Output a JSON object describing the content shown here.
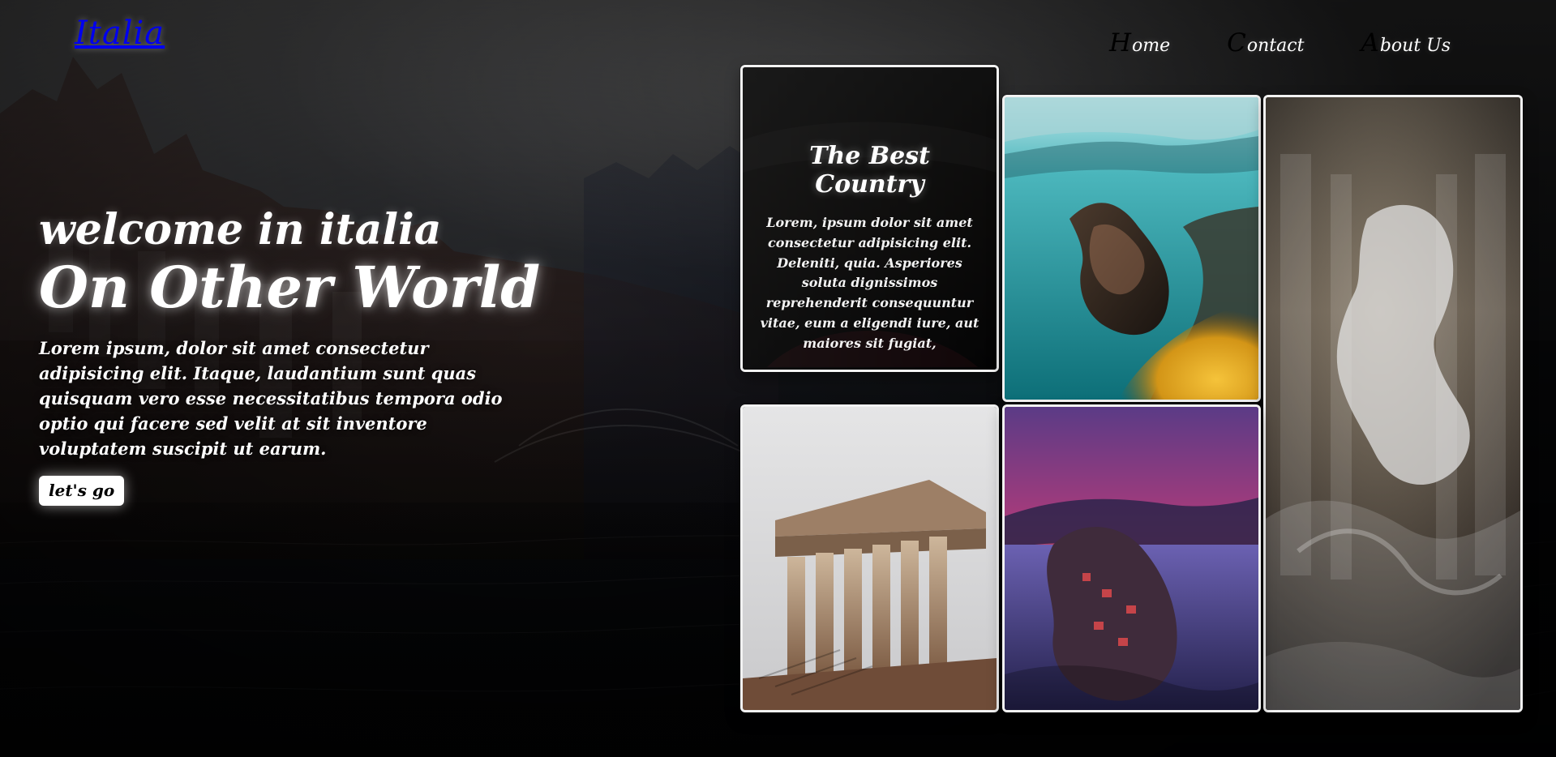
{
  "brand": {
    "logo_text": "Italia"
  },
  "nav": {
    "items": [
      {
        "first": "H",
        "rest": "ome"
      },
      {
        "first": "C",
        "rest": "ontact"
      },
      {
        "first": "A",
        "rest": "bout Us"
      }
    ]
  },
  "hero": {
    "line1": "welcome in italia",
    "line2": "On Other World",
    "description": "Lorem ipsum, dolor sit amet consectetur adipisicing elit. Itaque, laudantium sunt quas quisquam vero esse necessitatibus tempora odio optio qui facere sed velit at sit inventore voluptatem suscipit ut earum.",
    "cta_label": "let's go"
  },
  "cards": {
    "card1": {
      "title": "The Best Country",
      "text": "Lorem, ipsum dolor sit amet consectetur adipisicing elit. Deleniti, quia. Asperiores soluta dignissimos reprehenderit consequuntur vitae, eum a eligendi iure, aut maiores sit fugiat,"
    }
  },
  "icons": {
    "menu_icon": "none"
  },
  "colors": {
    "accent_white": "#ffffff",
    "nav_initial": "#000000"
  }
}
